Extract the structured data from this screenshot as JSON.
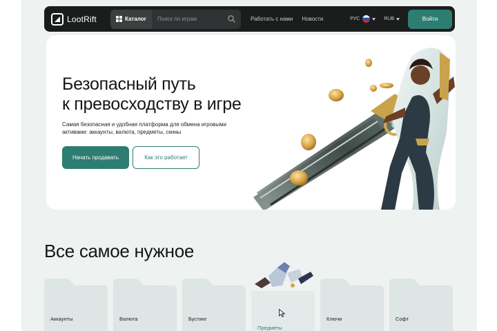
{
  "header": {
    "logo": "LootRift",
    "catalog_label": "Каталог",
    "search_placeholder": "Поиск по играм",
    "nav": [
      "Работать с нами",
      "Новости"
    ],
    "language": "РУС",
    "currency": "RUB",
    "login_label": "Войти"
  },
  "hero": {
    "title_line1": "Безопасный путь",
    "title_line2": "к превосходству в игре",
    "subtitle": "Самая безопасная и удобная платформа для обмена игровыми активами: аккаунты, валюта, предметы, скины",
    "primary_button": "Начать продавать",
    "secondary_button": "Как это работает"
  },
  "section": {
    "title": "Все самое нужное",
    "categories": [
      {
        "label": "Аккаунты",
        "active": false
      },
      {
        "label": "Валюта",
        "active": false
      },
      {
        "label": "Бустинг",
        "active": false
      },
      {
        "label": "Предметы",
        "active": true
      },
      {
        "label": "Ключи",
        "active": false
      },
      {
        "label": "Софт",
        "active": false
      }
    ]
  },
  "colors": {
    "accent": "#2d7d71",
    "header_bg": "#1b1d1d",
    "page_bg": "#eef2f1",
    "card_bg": "#dde6e5"
  },
  "icons": [
    "logo-icon",
    "grid-icon",
    "search-icon",
    "russia-flag-icon",
    "caret-down-icon",
    "folder-icon",
    "cursor-icon"
  ]
}
